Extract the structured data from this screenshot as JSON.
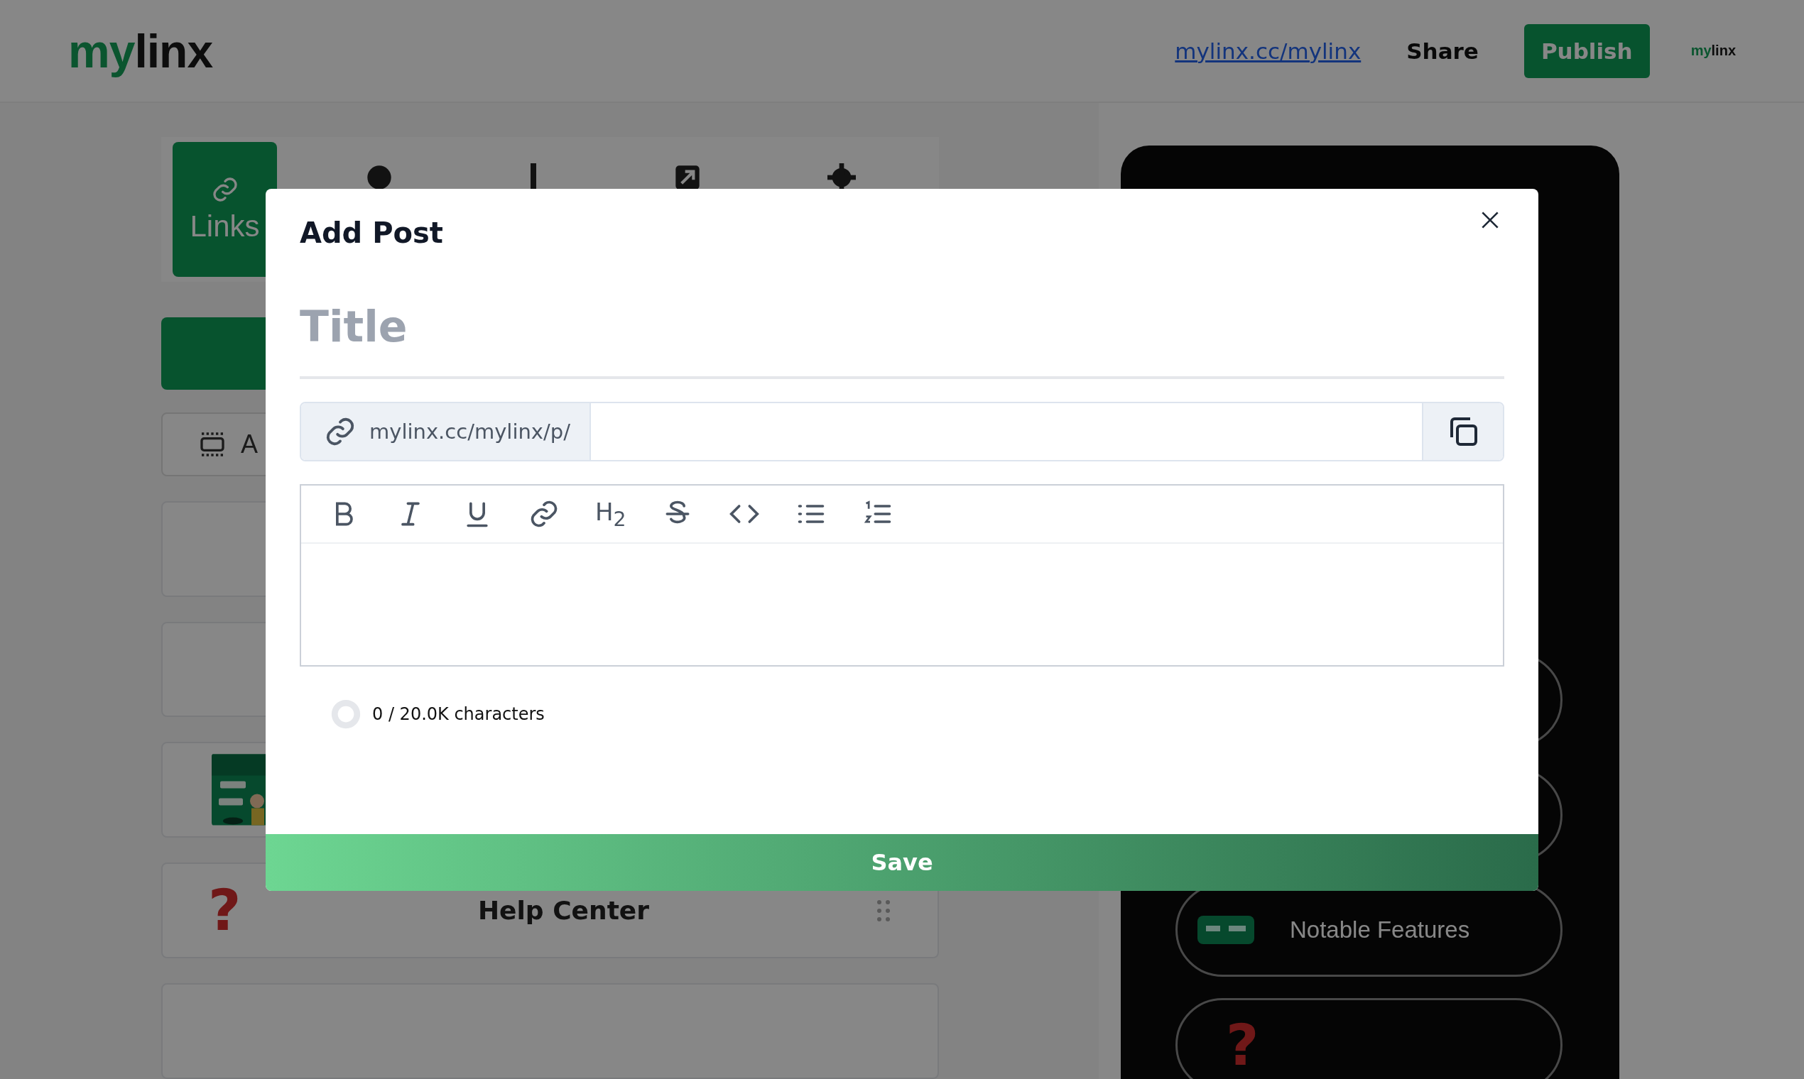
{
  "header": {
    "logo": [
      {
        "text": "my",
        "accent": true
      },
      {
        "text": "linx",
        "accent": false
      }
    ],
    "profile_link": "mylinx.cc/mylinx",
    "share": "Share",
    "publish": "Publish",
    "small_logo": [
      {
        "text": "my",
        "accent": true
      },
      {
        "text": "linx",
        "accent": false
      }
    ]
  },
  "editor_tabs": [
    {
      "label": "Links",
      "kind": "links",
      "selected": true
    },
    {
      "kind": "palette",
      "selected": false
    },
    {
      "kind": "stats",
      "selected": false
    },
    {
      "kind": "external",
      "selected": false
    },
    {
      "kind": "settings",
      "selected": false
    }
  ],
  "add_button": {
    "label": "A"
  },
  "link_cards": [
    {
      "kind": "blank"
    },
    {
      "kind": "blank"
    },
    {
      "kind": "thumbnail"
    },
    {
      "kind": "help",
      "icon": "?",
      "title": "Help Center"
    },
    {
      "kind": "blank"
    }
  ],
  "phone_preview": {
    "buttons": [
      {
        "kind": "blank"
      },
      {
        "kind": "blank"
      },
      {
        "kind": "thumbnail",
        "label": "Notable Features"
      },
      {
        "kind": "help",
        "icon": "?"
      }
    ]
  },
  "modal": {
    "title": "Add Post",
    "title_field": {
      "placeholder": "Title"
    },
    "url_prefix": "mylinx.cc/mylinx/p/",
    "toolbar": [
      {
        "kind": "bold"
      },
      {
        "kind": "italic"
      },
      {
        "kind": "underline"
      },
      {
        "kind": "link"
      },
      {
        "kind": "heading",
        "text": "H$_{2}$"
      },
      {
        "kind": "strike"
      },
      {
        "kind": "code"
      },
      {
        "kind": "bullet"
      },
      {
        "kind": "ordered"
      }
    ],
    "counter": "0 / 20.0K characters",
    "save": "Save"
  }
}
